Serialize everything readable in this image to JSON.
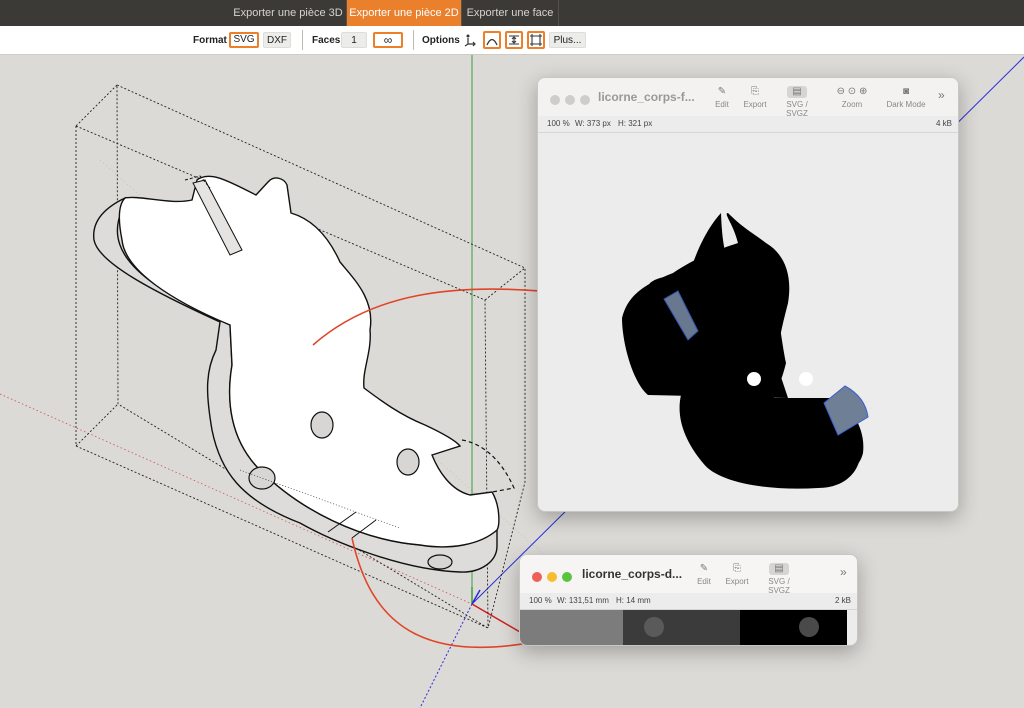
{
  "tabs": [
    {
      "label": "Exporter une pièce 3D",
      "active": false
    },
    {
      "label": "Exporter une pièce 2D",
      "active": true
    },
    {
      "label": "Exporter une face",
      "active": false
    }
  ],
  "toolbar": {
    "format_label": "Format",
    "format_svg": "SVG",
    "format_dxf": "DXF",
    "faces_label": "Faces",
    "faces_value": "1",
    "faces_infinite": "∞",
    "options_label": "Options",
    "more_label": "Plus..."
  },
  "window_top": {
    "title": "licorne_corps-f...",
    "tools": [
      "Edit",
      "Export",
      "SVG / SVGZ",
      "Zoom",
      "Dark Mode"
    ],
    "zoom": "100 %",
    "width": "W:  373 px",
    "height": "H:  321 px",
    "size": "4 kB"
  },
  "window_bottom": {
    "title": "licorne_corps-d...",
    "tools": [
      "Edit",
      "Export",
      "SVG / SVGZ"
    ],
    "zoom": "100 %",
    "width": "W:  131,51 mm",
    "height": "H:  14 mm",
    "size": "2 kB"
  },
  "colors": {
    "accent": "#ea7f2c",
    "arrow": "#e0452a",
    "close": "#ee5f57",
    "minimize": "#f5bd2f",
    "zoom": "#5ac43f"
  }
}
